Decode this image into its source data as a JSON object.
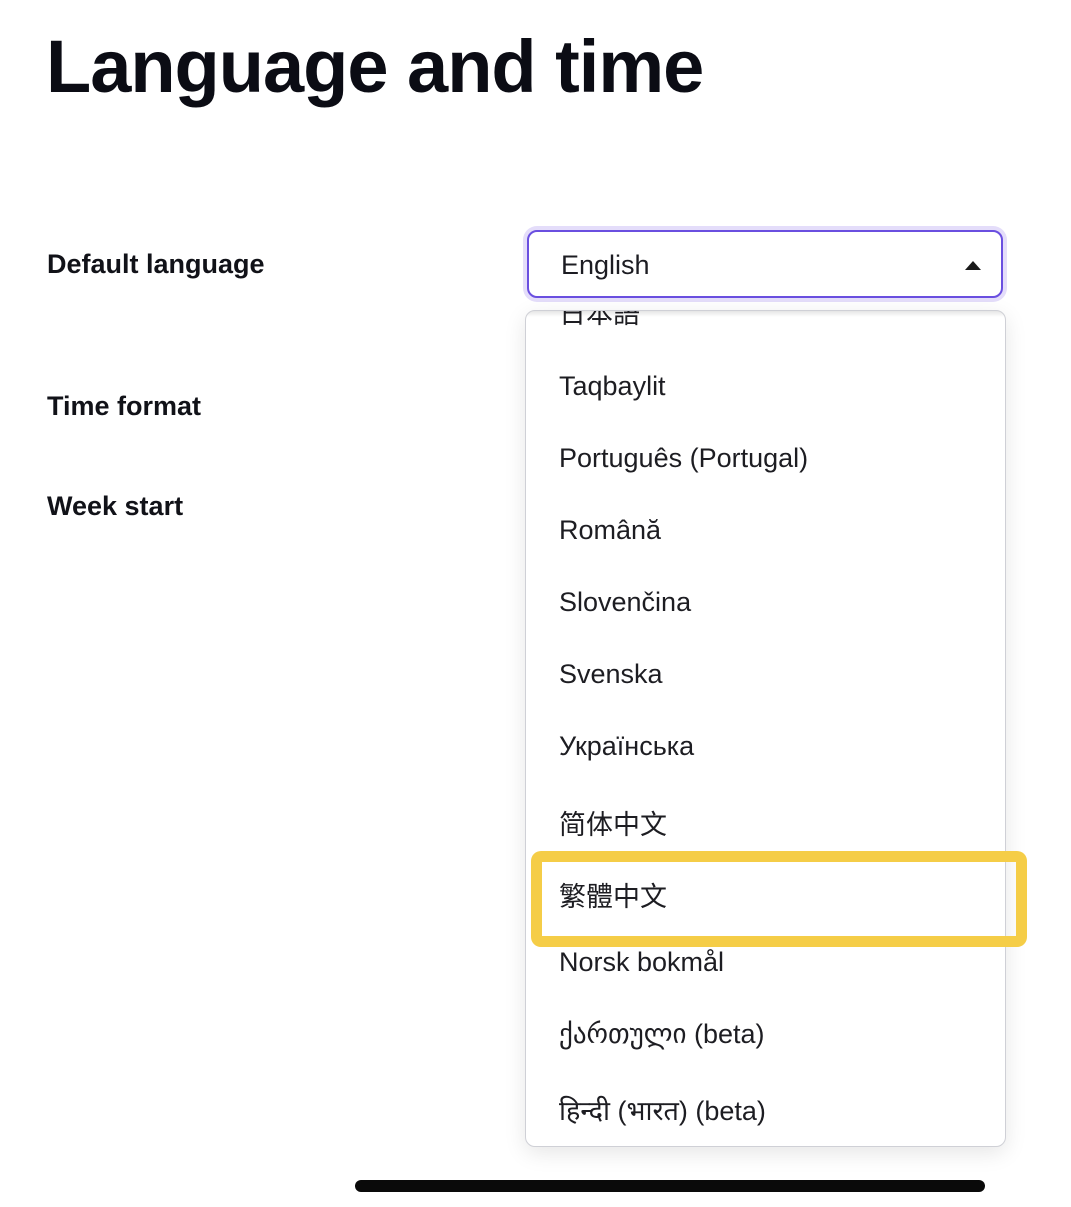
{
  "header": {
    "title": "Language and time"
  },
  "settings": {
    "default_language_label": "Default language",
    "time_format_label": "Time format",
    "week_start_label": "Week start"
  },
  "language_select": {
    "value": "English",
    "options": [
      "日本語",
      "Taqbaylit",
      "Português (Portugal)",
      "Română",
      "Slovenčina",
      "Svenska",
      "Українська",
      "简体中文",
      "繁體中文",
      "Norsk bokmål",
      "ქართული (beta)",
      "हिन्दी (भारत) (beta)"
    ]
  },
  "colors": {
    "focus_border": "#6a4fe0",
    "focus_ring": "#e4ddfa",
    "highlight": "#f5cd47"
  }
}
